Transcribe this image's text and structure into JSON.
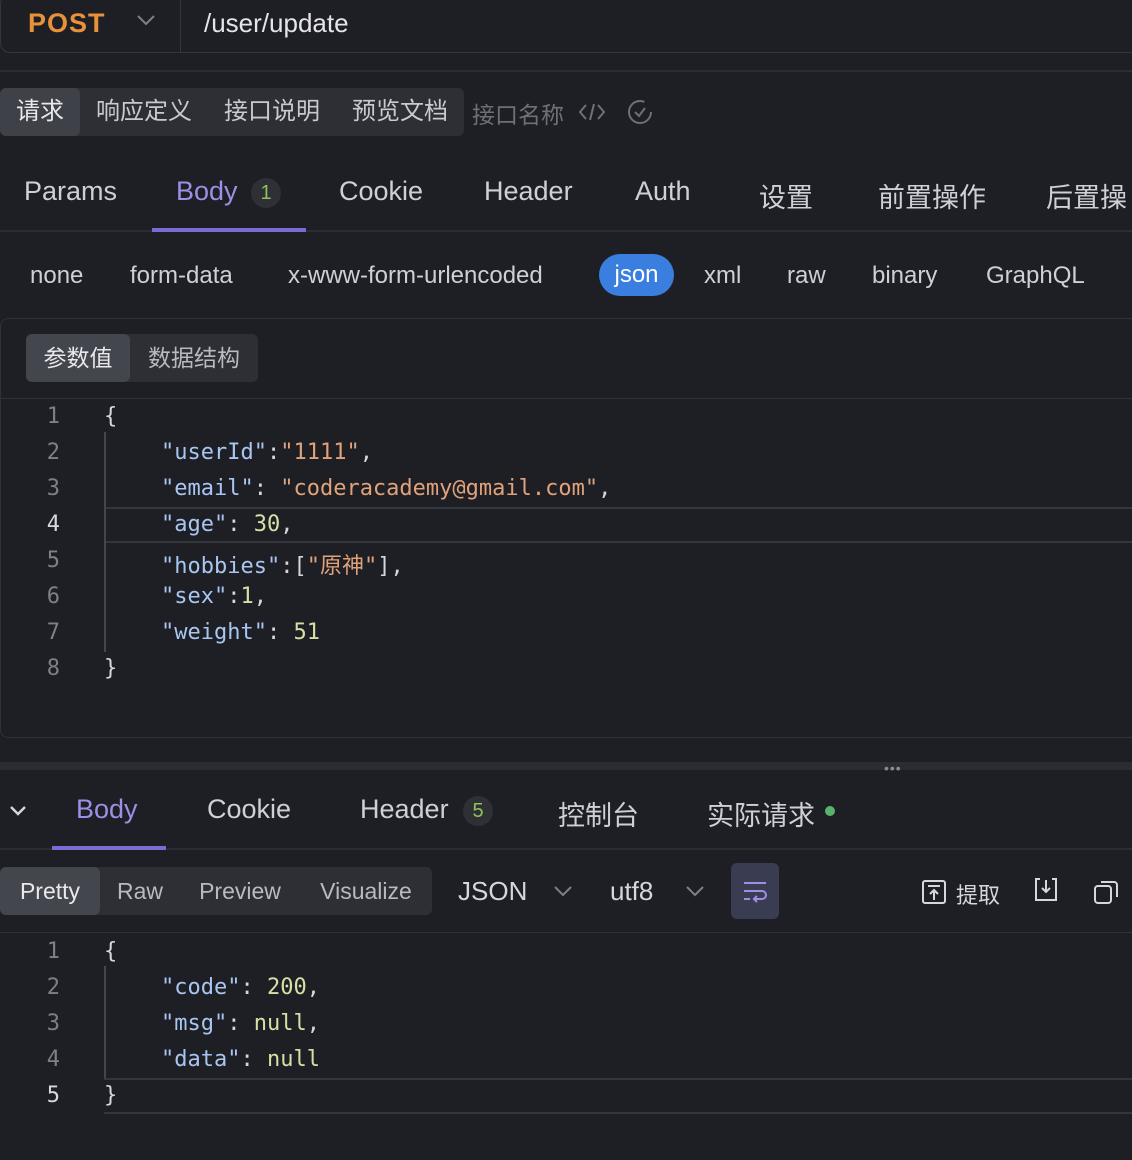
{
  "request": {
    "method": "POST",
    "url": "/user/update"
  },
  "doc_tabs": {
    "items": [
      "请求",
      "响应定义",
      "接口说明",
      "预览文档"
    ],
    "active": "请求",
    "name_placeholder": "接口名称"
  },
  "main_tabs": {
    "items": [
      "Params",
      "Body",
      "Cookie",
      "Header",
      "Auth",
      "设置",
      "前置操作",
      "后置操"
    ],
    "active": "Body",
    "body_badge": "1"
  },
  "body_types": {
    "items": [
      "none",
      "form-data",
      "x-www-form-urlencoded",
      "json",
      "xml",
      "raw",
      "binary",
      "GraphQL"
    ],
    "active": "json"
  },
  "editor_mode": {
    "items": [
      "参数值",
      "数据结构"
    ],
    "active": "参数值"
  },
  "request_body": {
    "line_numbers": [
      "1",
      "2",
      "3",
      "4",
      "5",
      "6",
      "7",
      "8"
    ],
    "current_line": "4",
    "open_brace": "{",
    "close_brace": "}",
    "fields": [
      {
        "key": "\"userId\"",
        "sep": ":",
        "value": "\"1111\"",
        "tail": ","
      },
      {
        "key": "\"email\"",
        "sep": ": ",
        "value": "\"coderacademy@gmail.com\"",
        "tail": ","
      },
      {
        "key": "\"age\"",
        "sep": ": ",
        "value": "30",
        "tail": ","
      },
      {
        "key": "\"hobbies\"",
        "sep": ":[",
        "value": "\"原神\"",
        "tail": "],"
      },
      {
        "key": "\"sex\"",
        "sep": ":",
        "value": "1",
        "tail": ","
      },
      {
        "key": "\"weight\"",
        "sep": ": ",
        "value": "51",
        "tail": ""
      }
    ]
  },
  "response_tabs": {
    "items": [
      "Body",
      "Cookie",
      "Header",
      "控制台",
      "实际请求"
    ],
    "active": "Body",
    "header_badge": "5"
  },
  "response_toolbar": {
    "formats": [
      "Pretty",
      "Raw",
      "Preview",
      "Visualize"
    ],
    "active_format": "Pretty",
    "language": "JSON",
    "encoding": "utf8",
    "extract_label": "提取"
  },
  "response_body": {
    "line_numbers": [
      "1",
      "2",
      "3",
      "4",
      "5"
    ],
    "current_line": "5",
    "open_brace": "{",
    "close_brace": "}",
    "fields": [
      {
        "key": "\"code\"",
        "sep": ": ",
        "value": "200",
        "tail": ","
      },
      {
        "key": "\"msg\"",
        "sep": ": ",
        "value": "null",
        "tail": ","
      },
      {
        "key": "\"data\"",
        "sep": ": ",
        "value": "null",
        "tail": ""
      }
    ]
  },
  "colors": {
    "method": "#e8913a",
    "accent": "#7b6bd4",
    "json_pill": "#3a7ee0",
    "json_key": "#a9c6f2",
    "json_string": "#e0a27a",
    "json_number": "#d6e0a6",
    "status_dot": "#57b36c"
  },
  "icons": [
    "chevron-down-icon",
    "code-icon",
    "history-icon",
    "wrap-lines-icon",
    "extract-icon",
    "download-icon",
    "copy-icon"
  ]
}
